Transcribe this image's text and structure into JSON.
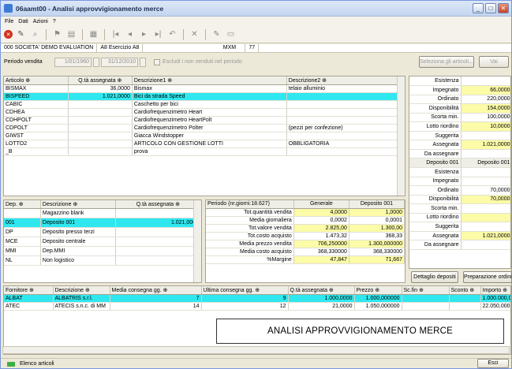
{
  "window": {
    "title": "06aamt00 - Analisi approvvigionamento merce"
  },
  "menu": [
    "File",
    "Dati",
    "Azioni",
    "?"
  ],
  "context": {
    "company": "000 SOCIETA' DEMO EVALUATION",
    "exercise": "A8 Esercizio A8",
    "code": "MXM",
    "num": "77"
  },
  "period": {
    "label": "Periodo vendita",
    "from": "1/01/1960",
    "to": "31/12/2010",
    "exclude_label": "Escludi i non venduti nel periodo",
    "select_articles": "Seleziona gli articoli...",
    "go": "Vai"
  },
  "articles": {
    "headers": [
      "Articolo",
      "Q.tà assegnata",
      "Descrizione1",
      "Descrizione2"
    ],
    "rows": [
      {
        "code": "BISMAX",
        "qty": "36,0000",
        "desc1": "Bismax",
        "desc2": "telaio alluminio"
      },
      {
        "code": "BISPEED",
        "qty": "1.021,0000",
        "desc1": "Bici da strada Speed",
        "desc2": ""
      },
      {
        "code": "CABIC",
        "qty": "",
        "desc1": "Caschetto per bici",
        "desc2": ""
      },
      {
        "code": "CDHEA",
        "qty": "",
        "desc1": "Cardiofrequenzimetro Heart",
        "desc2": ""
      },
      {
        "code": "CDHPOLT",
        "qty": "",
        "desc1": "Cardiofrequenzimetro HeartPolt",
        "desc2": ""
      },
      {
        "code": "CDPOLT",
        "qty": "",
        "desc1": "Cardiofrequenzimetro Polter",
        "desc2": "(pezzi per confezione)"
      },
      {
        "code": "GIWST",
        "qty": "",
        "desc1": "Giacca Windstopper",
        "desc2": ""
      },
      {
        "code": "LOTTO2",
        "qty": "",
        "desc1": "ARTICOLO CON GESTIONE LOTTI",
        "desc2": "OBBLIGATORIA"
      },
      {
        "code": "_B",
        "qty": "",
        "desc1": "prova",
        "desc2": ""
      }
    ]
  },
  "side": {
    "rows": [
      {
        "label": "Esistenza",
        "value": "",
        "style": "w"
      },
      {
        "label": "Impegnato",
        "value": "66,0000",
        "style": "y"
      },
      {
        "label": "Ordinato",
        "value": "220,0000",
        "style": "w"
      },
      {
        "label": "Disponibilità",
        "value": "154,0000",
        "style": "y"
      },
      {
        "label": "Scorta min.",
        "value": "100,0000",
        "style": "w"
      },
      {
        "label": "Lotto riordino",
        "value": "10,0000",
        "style": "y"
      },
      {
        "label": "Suggerita",
        "value": "",
        "style": "w"
      },
      {
        "label": "Assegnata",
        "value": "1.021,0000",
        "style": "y"
      },
      {
        "label": "Da assegnare",
        "value": "",
        "style": "w"
      },
      {
        "label": "Deposito 001",
        "value": "Deposito 001",
        "style": "h"
      },
      {
        "label": "Esistenza",
        "value": "",
        "style": "w"
      },
      {
        "label": "Impegnato",
        "value": "",
        "style": "w"
      },
      {
        "label": "Ordinato",
        "value": "70,0000",
        "style": "w"
      },
      {
        "label": "Disponibilità",
        "value": "70,0000",
        "style": "y"
      },
      {
        "label": "Scorta min.",
        "value": "",
        "style": "w"
      },
      {
        "label": "Lotto riordino",
        "value": "",
        "style": "y"
      },
      {
        "label": "Suggerita",
        "value": "",
        "style": "w"
      },
      {
        "label": "Assegnata",
        "value": "1.021,0000",
        "style": "y"
      },
      {
        "label": "Da assegnare",
        "value": "",
        "style": "w"
      }
    ],
    "btn_deposits": "Dettaglio depositi",
    "btn_prepare": "Preparazione ordini"
  },
  "deposits": {
    "headers": [
      "Dep.",
      "Descrizione",
      "Q.tà assegnata"
    ],
    "rows": [
      {
        "code": "",
        "desc": "Magazzino blank",
        "qty": ""
      },
      {
        "code": "001",
        "desc": "Deposito 001",
        "qty": "1.021,0000"
      },
      {
        "code": "DP",
        "desc": "Deposito presso terzi",
        "qty": ""
      },
      {
        "code": "MCE",
        "desc": "Deposito centrale",
        "qty": ""
      },
      {
        "code": "MMI",
        "desc": "Dep.MMI",
        "qty": ""
      },
      {
        "code": "NL",
        "desc": "Non logistico",
        "qty": ""
      }
    ]
  },
  "stats": {
    "headers": [
      "Periodo (nr.giorni:18.627)",
      "Generale",
      "Deposito 001"
    ],
    "rows": [
      {
        "label": "Tot.quantità vendita",
        "gen": "4,0000",
        "dep": "1,0000"
      },
      {
        "label": "Media giornaliera",
        "gen": "0,0002",
        "dep": "0,0001"
      },
      {
        "label": "Tot.valore vendita",
        "gen": "2.825,00",
        "dep": "1.300,00"
      },
      {
        "label": "Tot.costo acquisto",
        "gen": "1.473,32",
        "dep": "368,33"
      },
      {
        "label": "Media prezzo vendita",
        "gen": "706,250000",
        "dep": "1.300,000000"
      },
      {
        "label": "Media costo acquisto",
        "gen": "368,330000",
        "dep": "368,330000"
      },
      {
        "label": "%Margine",
        "gen": "47,847",
        "dep": "71,667"
      }
    ]
  },
  "suppliers": {
    "headers": [
      "Fornitore",
      "Descrizione",
      "Media consegna gg.",
      "Ultima consegna gg.",
      "Q.tà assegnata",
      "Prezzo",
      "Sc.fin",
      "Sconto",
      "Importo"
    ],
    "rows": [
      {
        "code": "ALBAT",
        "desc": "ALBATRIS s.r.l.",
        "avg": "7",
        "last": "9",
        "qty": "1.000,0000",
        "price": "1.000,000000",
        "scfin": "",
        "disc": "",
        "amount": "1.000.000,000"
      },
      {
        "code": "ATEC",
        "desc": "ATECIS s.n.c. di MM",
        "avg": "14",
        "last": "12",
        "qty": "21,0000",
        "price": "1.050,000000",
        "scfin": "",
        "disc": "",
        "amount": "22.050,000"
      }
    ]
  },
  "overlay": "ANALISI APPROVVIGIONAMENTO MERCE",
  "status": {
    "text": "Elenco articoli",
    "exit": "Esci"
  }
}
